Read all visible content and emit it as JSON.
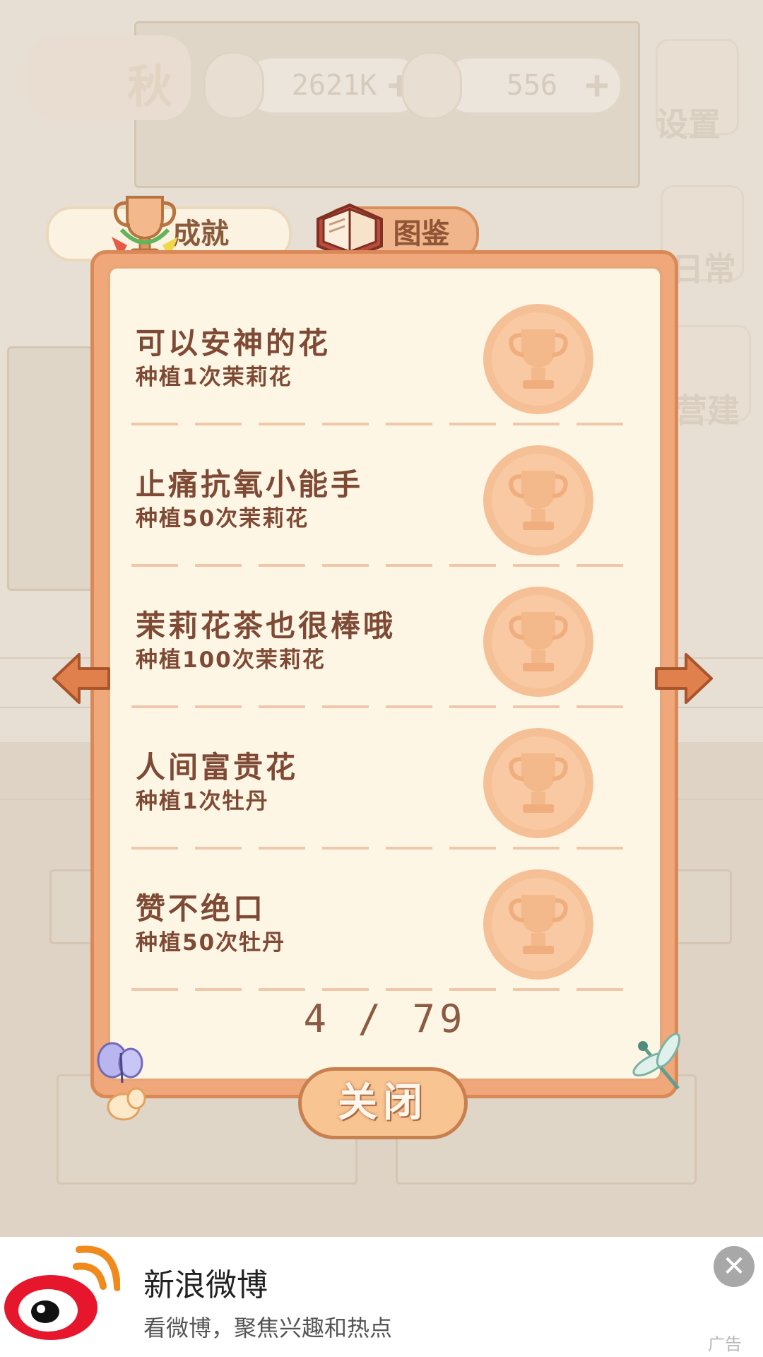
{
  "header": {
    "season": "秋",
    "fish_currency": "2621K",
    "cheese_currency": "556",
    "settings_label": "设置",
    "side_labels": [
      "日常",
      "营建"
    ]
  },
  "tabs": [
    {
      "label": "成就",
      "active": true
    },
    {
      "label": "图鉴",
      "active": false
    }
  ],
  "achievements": [
    {
      "title": "可以安神的花",
      "requirement": "种植1次茉莉花"
    },
    {
      "title": "止痛抗氧小能手",
      "requirement": "种植50次茉莉花"
    },
    {
      "title": "茉莉花茶也很棒哦",
      "requirement": "种植100次茉莉花"
    },
    {
      "title": "人间富贵花",
      "requirement": "种植1次牡丹"
    },
    {
      "title": "赞不绝口",
      "requirement": "种植50次牡丹"
    }
  ],
  "pagination": {
    "text": "4 / 79"
  },
  "close_label": "关闭",
  "ad": {
    "title": "新浪微博",
    "subtitle": "看微博，聚焦兴趣和热点",
    "tag": "广告"
  },
  "colors": {
    "panel_border": "#f0a77a",
    "panel_bg": "#fdf6e4",
    "text_brown": "#7e4a35",
    "medal": "#f6c096"
  }
}
